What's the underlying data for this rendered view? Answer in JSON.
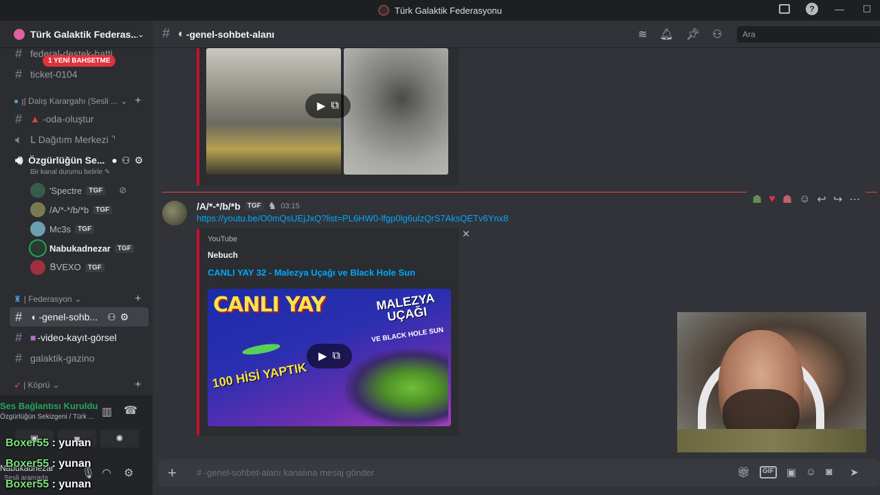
{
  "window": {
    "title": "Türk Galaktik Federasyonu"
  },
  "guild": {
    "name": "Türk Galaktik Federas..."
  },
  "sidebar": {
    "mention_pill": "1 YENİ BAHSETME",
    "channels_top": [
      {
        "name": "federal-destek-hatti"
      },
      {
        "name": "ticket-0104"
      }
    ],
    "cat1": "ꞁ| Dalış Karargahı (Sesli ...",
    "cat1_channels": [
      {
        "name": "-oda-oluştur"
      },
      {
        "name": "ᒪ Dağıtım Merkezi ⌝"
      },
      {
        "name": "Özgürlüğün Se..."
      }
    ],
    "voice_status": "Bir kanal durumu belirle",
    "voice_users": [
      {
        "name": "'Spectre",
        "tag": "TGF"
      },
      {
        "name": "/A/*-*/b/*b",
        "tag": "TGF"
      },
      {
        "name": "Mc3s",
        "tag": "TGF"
      },
      {
        "name": "Nabukadnezar",
        "tag": "TGF"
      },
      {
        "name": "ՑVEXO",
        "tag": "TGF"
      }
    ],
    "cat2": "| Federasyon",
    "cat2_channels": [
      {
        "name": "-genel-sohb..."
      },
      {
        "name": "-video-kayıt-görsel"
      },
      {
        "name": "galaktik-gazino"
      }
    ],
    "cat3": "| Köprü"
  },
  "voice_panel": {
    "status": "Ses Bağlantısı Kuruldu",
    "sub": "Özgürlüğün Sekizgeni / Türk ..."
  },
  "user_panel": {
    "name": "Nabukadnezar",
    "status": "Sesli aramada"
  },
  "overlay_chat": [
    {
      "nick": "Boxer55",
      "text": " : yunan"
    },
    {
      "nick": "Boxer55",
      "text": " : yunan"
    },
    {
      "nick": "Boxer55",
      "text": " : yunan"
    }
  ],
  "topbar": {
    "channel": "-genel-sohbet-alanı",
    "search_placeholder": "Ara"
  },
  "message": {
    "author": "/A/*-*/b/*b",
    "tag": "TGF",
    "time": "03:15",
    "link": "https://youtu.be/O0mQsUEjJxQ?list=PL6HW0-lfgp0lg6uIzQrS7AksQETv6Ynx8",
    "embed": {
      "provider": "YouTube",
      "author": "Nebuch",
      "title": "CANLI YAY 32 - Malezya Uçağı ve Black Hole Sun",
      "thumb_title": "CANLI YAY",
      "thumb_side": "MALEZYA UÇAĞI",
      "thumb_side2": "VE BLACK HOLE SUN",
      "thumb_badge": "100 HİSİ YAPTIK"
    }
  },
  "composer": {
    "placeholder": "# -genel-sohbet-alanı kanalına mesaj gönder"
  },
  "colors": {
    "accent": "#c8102e",
    "link": "#00a8fc",
    "online": "#23a55a",
    "mention": "#e0323b"
  }
}
